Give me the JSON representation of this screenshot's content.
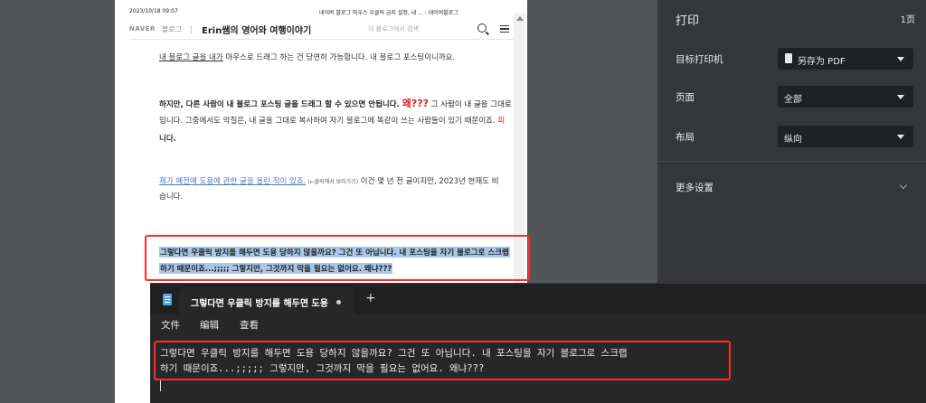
{
  "page": {
    "date": "2023/10/18 09:07",
    "title": "네이버 블로그 마우스 우클릭 금지 설정, 내 ... : 네이버블로그",
    "naver_logo": "NAVER",
    "naver_blog": "블로그",
    "blog_name": "Erin쌤의 영어와 여행이야기",
    "search_placeholder": "이 블로그에서 검색",
    "p1_link": "내 블로그 글을 내가",
    "p1_rest": " 마우스로 드래그 하는 건 당연히 가능합니다. 내 블로그 포스팅이니까요.",
    "p2_main": "하지만, 다른 사람이 내 블로그 포스팅 글을 드래그 할 수 있으면 안됩니다. ",
    "p2_red": "왜???",
    "p2_rest": " 그 사람이 내 글을 그대로",
    "p3": "입니다. 그중에서도 악질은, 내 글을 그대로 복사하여 자기 블로그에 똑같이 쓰는 사람들이 있기 때문이죠.",
    "p3_tail": " 피",
    "p4": "니다.",
    "p5_link": "제가 예전에 도용에 관한 글을 올린 적이 있죠.",
    "p5_small": " (←클릭해서 보러가기)",
    "p5_rest": " 이건 몇 년 전 글이지만, 2023년 현재도 비",
    "p6": "습니다.",
    "sel1": "그렇다면 우클릭 방지를 해두면 도용 당하지 않을까요? 그건 또 아닙니다. 내 포스팅을 자기 블로그로 스크랩",
    "sel2": "하기 때문이죠...;;;;; 그렇지만, 그것까지 막을 필요는 없어요. 왜냐???"
  },
  "print_panel": {
    "title": "打印",
    "pages": "1页",
    "destination_label": "目标打印机",
    "destination_value": "另存为 PDF",
    "pages_label": "页面",
    "pages_value": "全部",
    "layout_label": "布局",
    "layout_value": "纵向",
    "more_settings": "更多设置"
  },
  "notepad": {
    "tab_title": "그렇다면 우클릭 방지를 해두면 도용",
    "new_tab": "+",
    "menu_file": "文件",
    "menu_edit": "编辑",
    "menu_view": "查看",
    "line1": "그렇다면 우클릭 방지를 해두면 도용 당하지 않을까요? 그건 또 아닙니다. 내 포스팅을 자기 블로그로 스크랩",
    "line2": "하기 때문이죠...;;;;; 그렇지만, 그것까지 막을 필요는 없어요. 왜냐???"
  },
  "colors": {
    "highlight_red": "#ff2a2a",
    "selection_blue": "#a9c7e8",
    "panel_bg": "#35363a"
  }
}
